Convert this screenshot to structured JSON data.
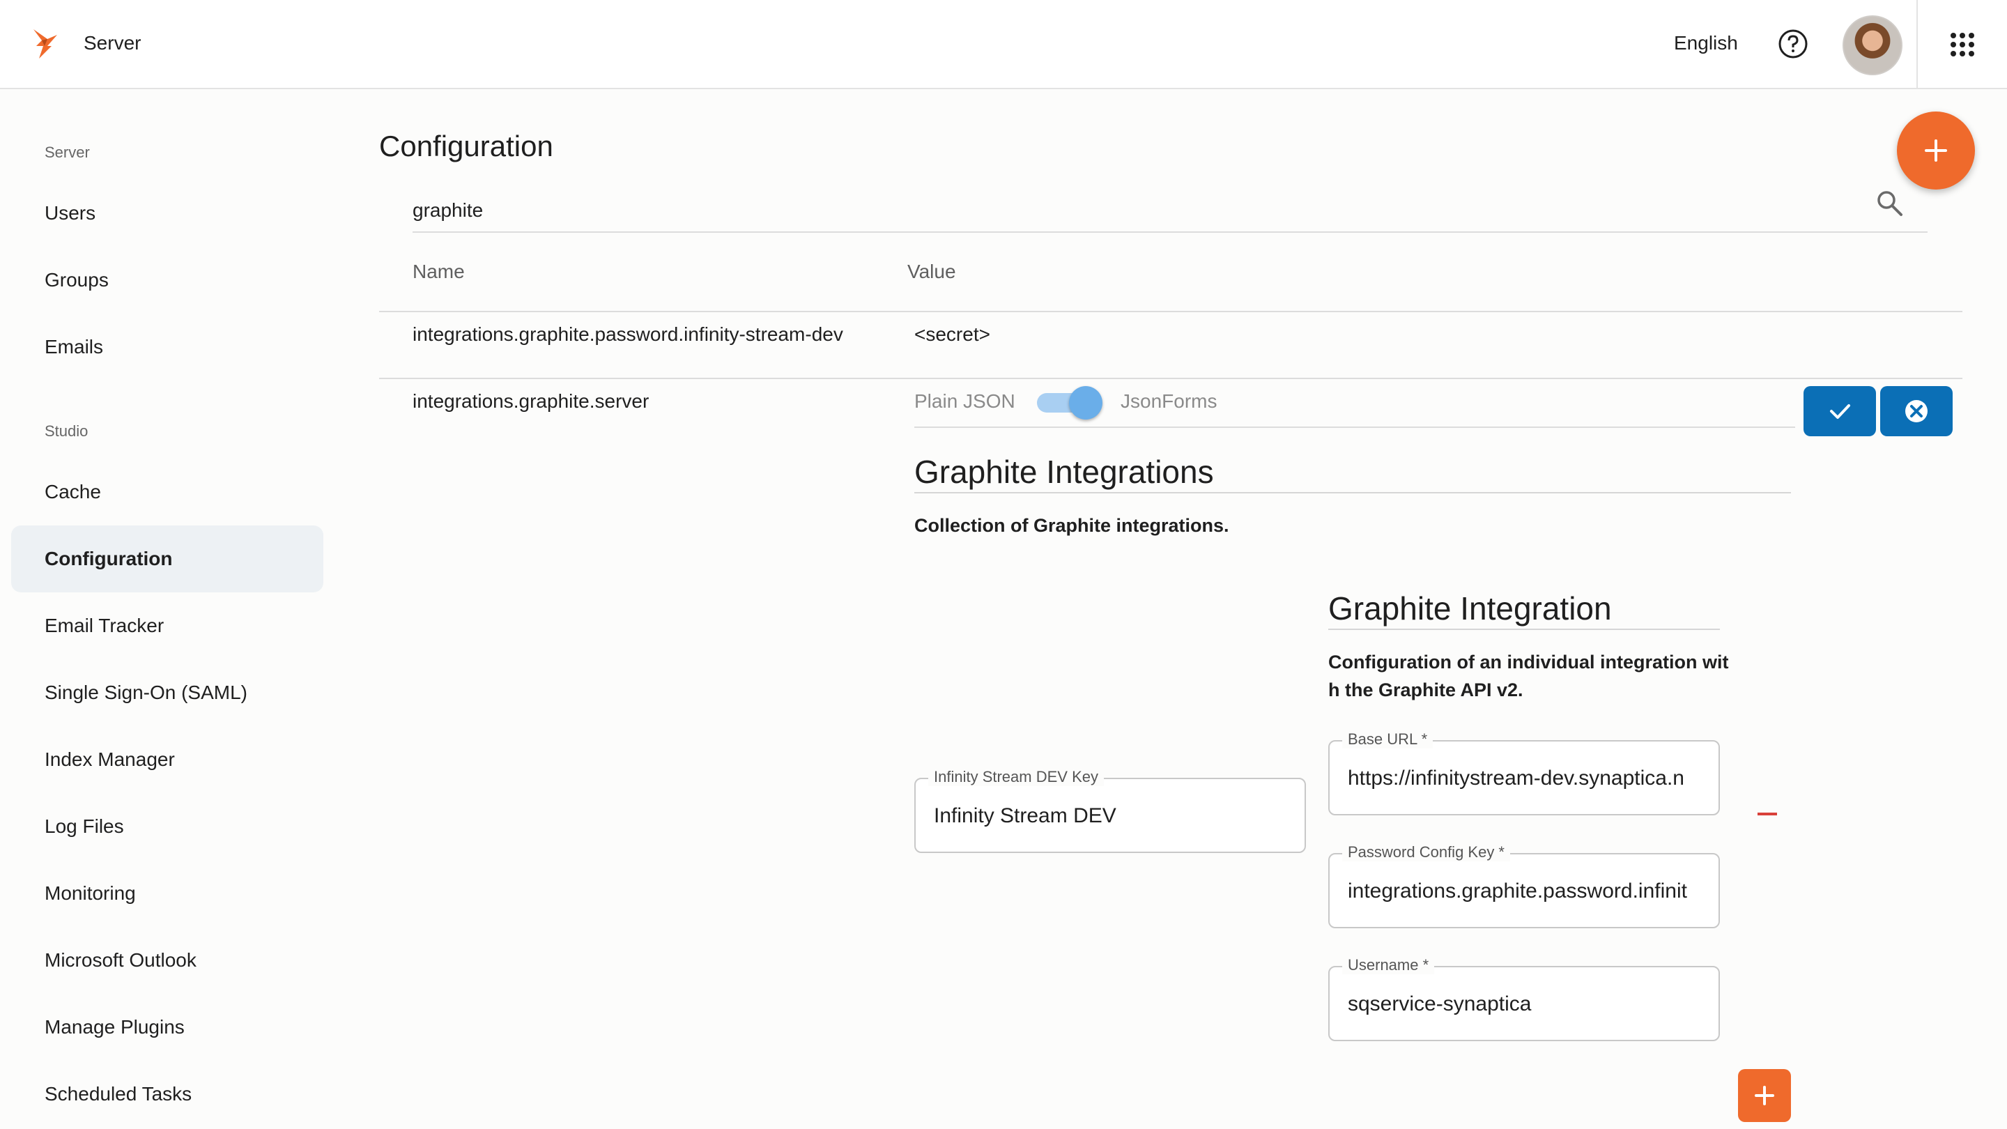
{
  "header": {
    "app_title": "Server",
    "language": "English",
    "help_icon": "help-circle-icon",
    "apps_icon": "apps-grid-icon"
  },
  "sidebar": {
    "sections": [
      {
        "title": "Server",
        "items": [
          "Users",
          "Groups",
          "Emails"
        ]
      },
      {
        "title": "Studio",
        "items": [
          "Cache",
          "Configuration",
          "Email Tracker",
          "Single Sign-On (SAML)",
          "Index Manager",
          "Log Files",
          "Monitoring",
          "Microsoft Outlook",
          "Manage Plugins",
          "Scheduled Tasks"
        ]
      }
    ],
    "active_item": "Configuration"
  },
  "main": {
    "title": "Configuration",
    "search_value": "graphite",
    "columns": {
      "name": "Name",
      "value": "Value"
    },
    "rows": [
      {
        "name": "integrations.graphite.password.infinity-stream-dev",
        "value": "<secret>"
      },
      {
        "name": "integrations.graphite.server",
        "value": ""
      }
    ],
    "editor": {
      "toggle_left": "Plain JSON",
      "toggle_right": "JsonForms",
      "toggle_on": true,
      "heading": "Graphite Integrations",
      "description": "Collection of Graphite integrations.",
      "key_field": {
        "label": "Infinity Stream DEV Key",
        "value": "Infinity Stream DEV"
      },
      "sub_heading": "Graphite Integration",
      "sub_description_line1": "Configuration of an individual integration wit",
      "sub_description_line2": "h the Graphite API v2.",
      "fields": {
        "base_url": {
          "label": "Base URL *",
          "value": "https://infinitystream-dev.synaptica.n"
        },
        "password_key": {
          "label": "Password Config Key *",
          "value": "integrations.graphite.password.infinit"
        },
        "username": {
          "label": "Username *",
          "value": "sqservice-synaptica"
        }
      }
    }
  },
  "colors": {
    "accent": "#ef6a2c",
    "primary": "#0b6fb6",
    "toggle": "#6aaee9",
    "remove": "#d9403a"
  }
}
